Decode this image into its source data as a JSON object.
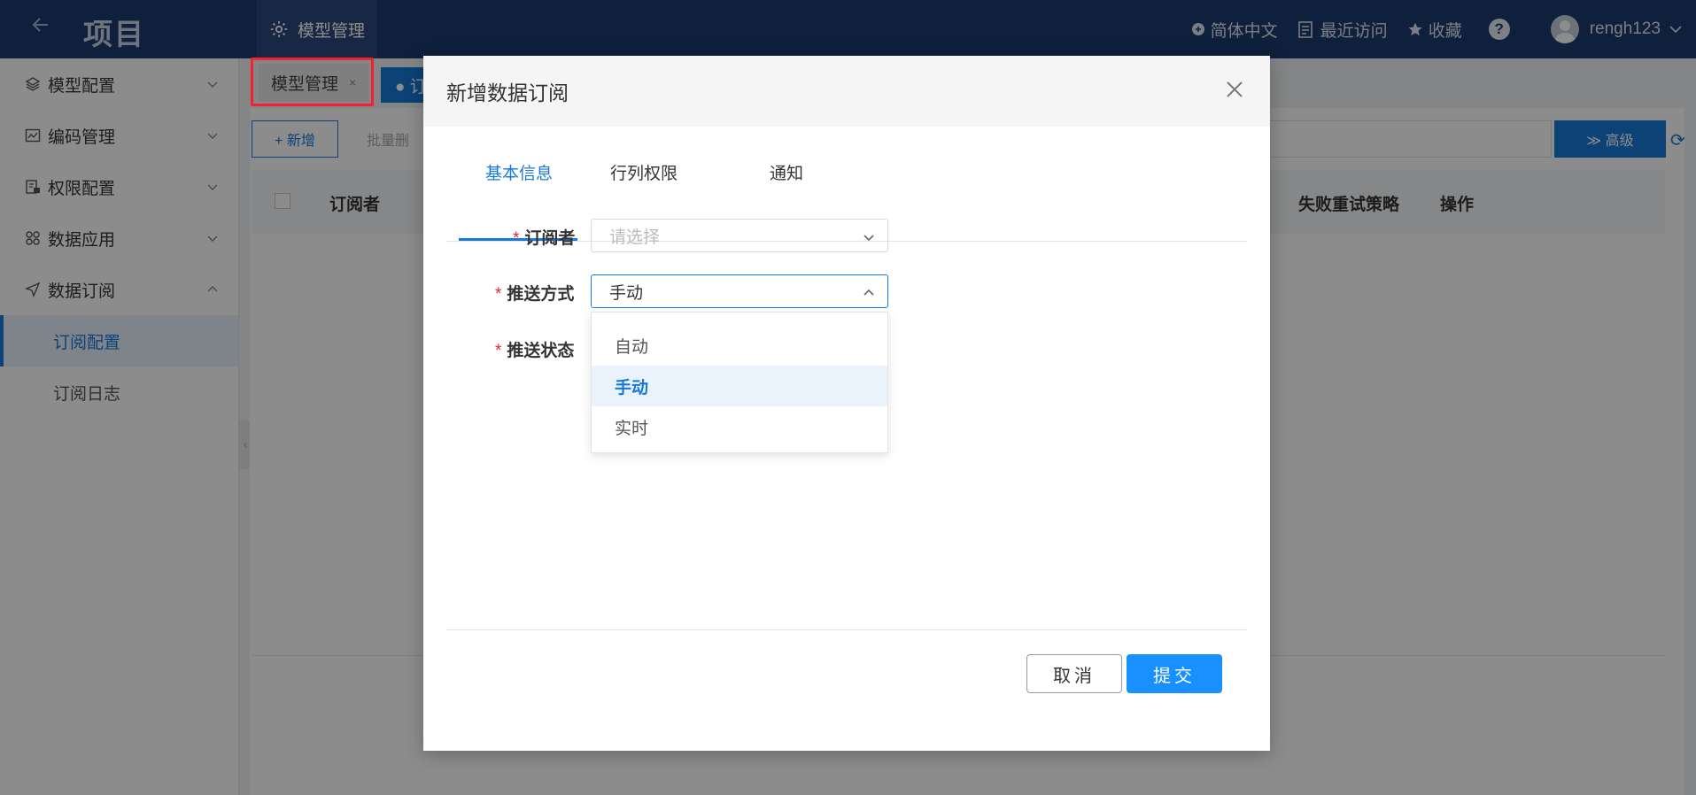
{
  "header": {
    "back_icon": "arrow-left-icon",
    "title": "项目",
    "module_label": "模型管理",
    "language": "简体中文",
    "recent": "最近访问",
    "favorites": "收藏",
    "help": "?",
    "username": "rengh123"
  },
  "sidebar": {
    "items": [
      {
        "label": "模型配置",
        "icon": "layers-icon"
      },
      {
        "label": "编码管理",
        "icon": "code-icon"
      },
      {
        "label": "权限配置",
        "icon": "lock-doc-icon"
      },
      {
        "label": "数据应用",
        "icon": "apps-icon"
      },
      {
        "label": "数据订阅",
        "icon": "send-icon"
      }
    ],
    "sub_items": [
      {
        "label": "订阅配置",
        "active": true
      },
      {
        "label": "订阅日志",
        "active": false
      }
    ]
  },
  "page_tabs": {
    "tab1": "模型管理",
    "tab1_close": "×",
    "tab2": "● 订"
  },
  "toolbar": {
    "add_label": "+ 新增",
    "batch_label": "批量删",
    "advanced_label": "≫ 高级"
  },
  "table": {
    "col_subscriber": "订阅者",
    "col_retry": "失败重试策略",
    "col_action": "操作"
  },
  "modal": {
    "title": "新增数据订阅",
    "tabs": [
      "基本信息",
      "行列权限",
      "通知"
    ],
    "active_tab": 0,
    "fields": {
      "subscriber_label": "订阅者",
      "subscriber_placeholder": "请选择",
      "push_mode_label": "推送方式",
      "push_mode_value": "手动",
      "push_status_label": "推送状态"
    },
    "required_mark": "*",
    "dropdown_options": [
      "自动",
      "手动",
      "实时"
    ],
    "dropdown_selected": "手动",
    "cancel_label": "取消",
    "submit_label": "提交"
  },
  "colors": {
    "header_bg": "#1d3b6e",
    "accent": "#1779d8",
    "primary_button": "#1890ff",
    "required": "#f5222d",
    "highlight_box": "#f5222d"
  }
}
